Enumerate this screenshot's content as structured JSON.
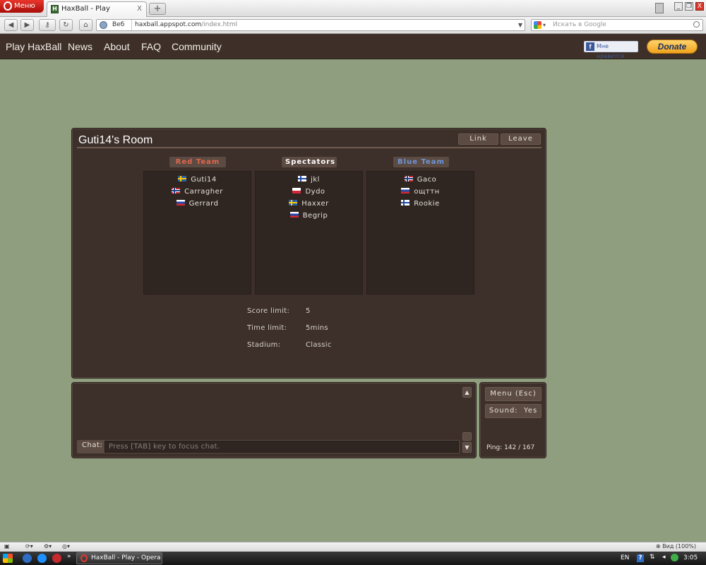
{
  "browser": {
    "menu_label": "Меню",
    "tab_title": "HaxBall - Play",
    "tab_close": "X",
    "new_tab": "+",
    "security_label": "Веб",
    "url_host": "haxball.appspot.com",
    "url_path": "/index.html",
    "search_placeholder": "Искать в Google",
    "search_engine_icon": "google-icon",
    "window_buttons": [
      "_",
      "❐",
      "X"
    ]
  },
  "site": {
    "nav": [
      "Play HaxBall",
      "News",
      "About",
      "FAQ",
      "Community"
    ],
    "fb_like_label": "Мне нравится",
    "donate_label": "Donate"
  },
  "room": {
    "title": "Guti14's Room",
    "link_label": "Link",
    "leave_label": "Leave",
    "teams": {
      "red": {
        "label": "Red Team",
        "color": "#e4654b",
        "players": [
          {
            "name": "Guti14",
            "flag": "se"
          },
          {
            "name": "Carragher",
            "flag": "no"
          },
          {
            "name": "Gerrard",
            "flag": "ru"
          }
        ]
      },
      "spectators": {
        "label": "Spectators",
        "color": "#ffffff",
        "players": [
          {
            "name": "jkl",
            "flag": "fi"
          },
          {
            "name": "Dydo",
            "flag": "pl"
          },
          {
            "name": "Haxxer",
            "flag": "se"
          },
          {
            "name": "Begrip",
            "flag": "ru"
          }
        ]
      },
      "blue": {
        "label": "Blue Team",
        "color": "#6d95d8",
        "players": [
          {
            "name": "Gaco",
            "flag": "no"
          },
          {
            "name": "ощттн",
            "flag": "ru"
          },
          {
            "name": "Rookie",
            "flag": "fi"
          }
        ]
      }
    },
    "settings": {
      "score_label": "Score limit:",
      "score_value": "5",
      "time_label": "Time limit:",
      "time_value": "5mins",
      "stadium_label": "Stadium:",
      "stadium_value": "Classic"
    }
  },
  "chat": {
    "label": "Chat:",
    "placeholder": "Press [TAB] key to focus chat.",
    "value": "",
    "scroll_up": "▲",
    "scroll_down": "▼"
  },
  "side": {
    "menu_label": "Menu (Esc)",
    "sound_label": "Sound:",
    "sound_value": "Yes",
    "ping_label": "Ping:",
    "ping_value": "142 / 167"
  },
  "statusbar": {
    "zoom_label": "Вид (100%)"
  },
  "taskbar": {
    "window_label": "HaxBall - Play - Opera",
    "lang": "EN",
    "help": "?",
    "time": "3:05"
  }
}
